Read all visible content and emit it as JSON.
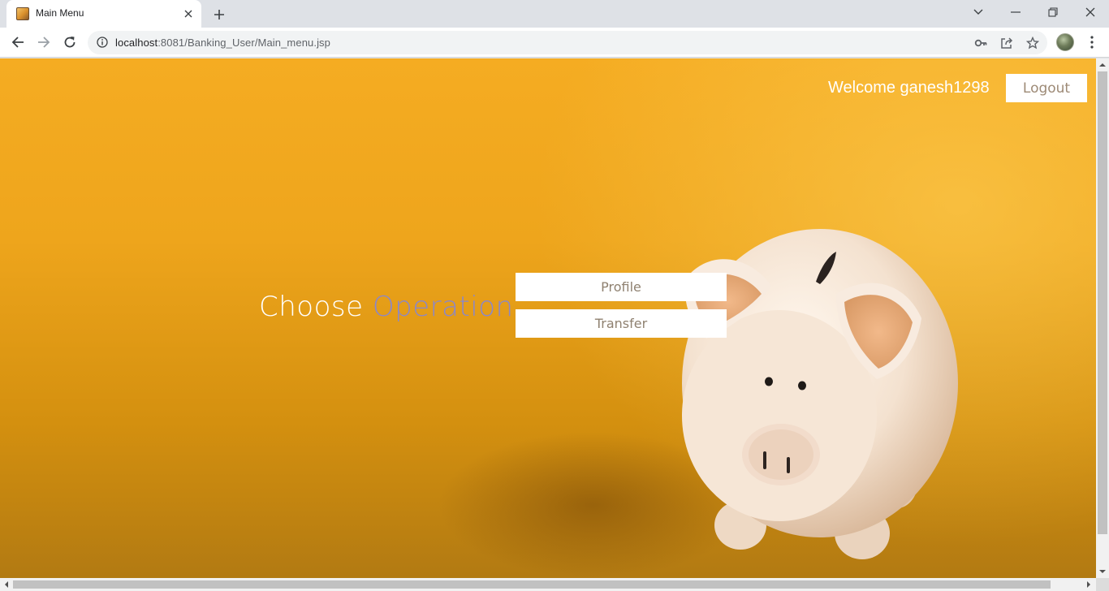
{
  "browser": {
    "tab_title": "Main Menu",
    "url_host": "localhost",
    "url_rest": ":8081/Banking_User/Main_menu.jsp"
  },
  "page": {
    "welcome_text": "Welcome ganesh1298",
    "logout_label": "Logout",
    "heading_part1": "Choose",
    "heading_part2": "Operation",
    "buttons": [
      {
        "label": "Profile"
      },
      {
        "label": "Transfer"
      }
    ]
  },
  "colors": {
    "background_orange": "#f5ac22",
    "heading_accent": "#8b87c9",
    "button_text": "#8f8170"
  },
  "icons": {
    "favicon": "piggy-bank-favicon",
    "tab_close": "close-icon",
    "new_tab": "plus-icon",
    "back": "arrow-left-icon",
    "forward": "arrow-right-icon",
    "reload": "reload-icon",
    "site_info": "info-icon",
    "password": "key-icon",
    "share": "share-icon",
    "bookmark": "star-icon",
    "menu": "three-dots-icon"
  }
}
